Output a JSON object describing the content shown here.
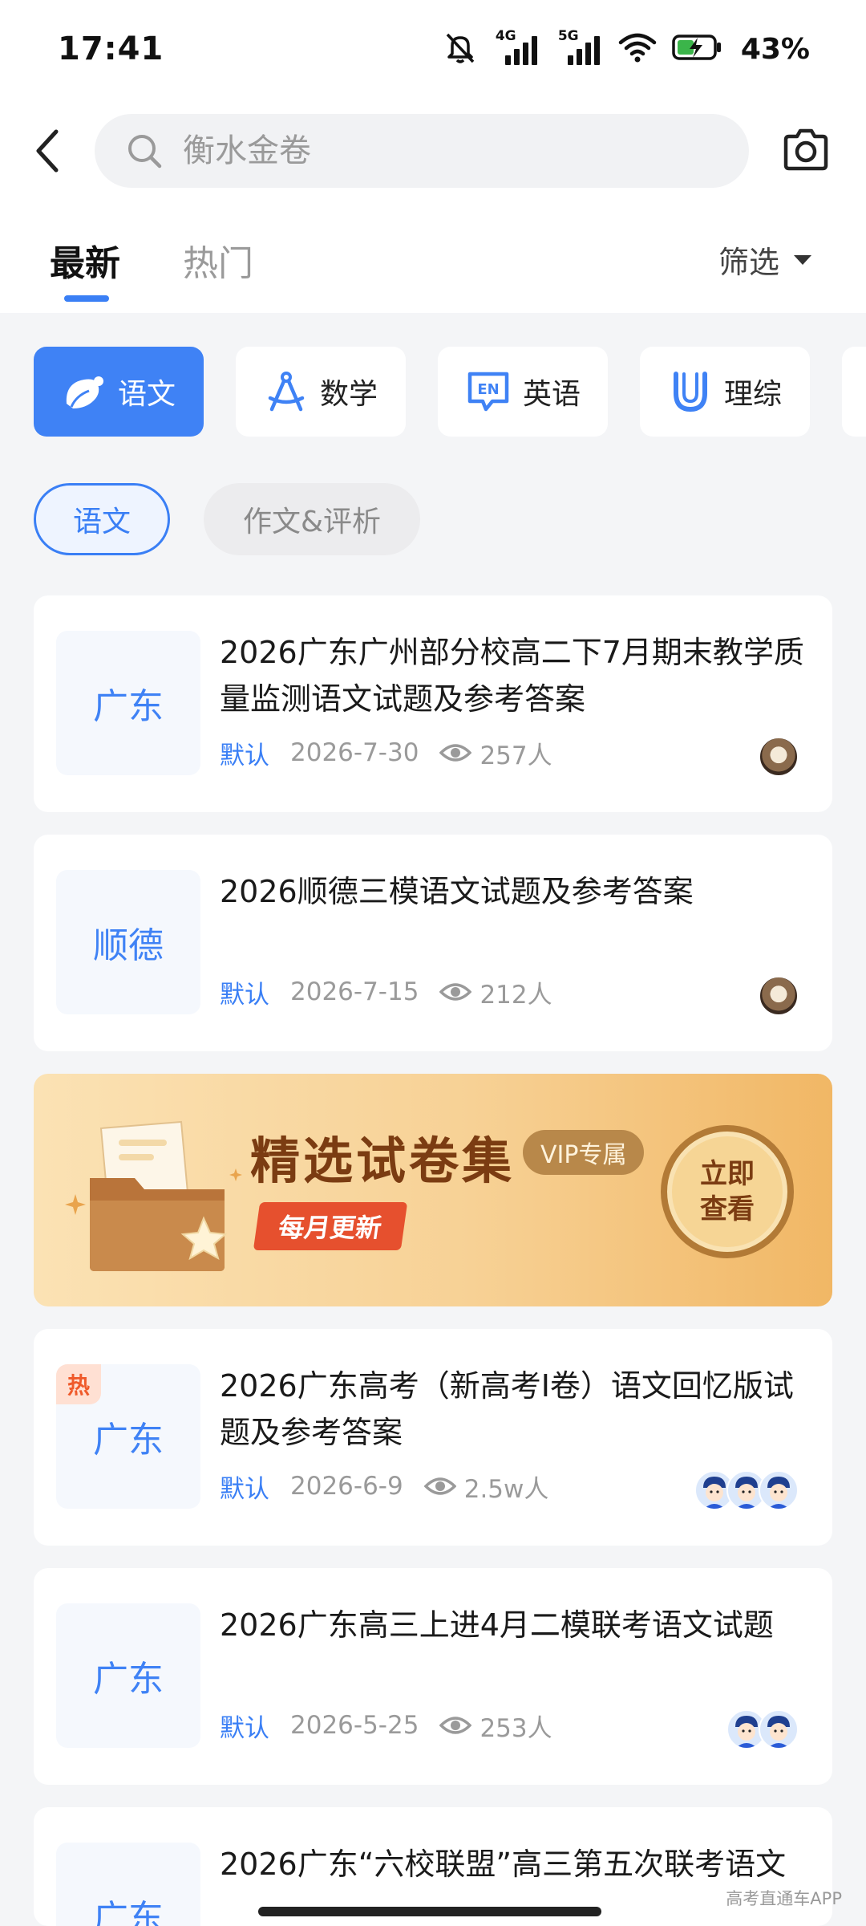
{
  "status_bar": {
    "time": "17:41",
    "network_1": "4G",
    "network_2": "5G",
    "battery": "43%"
  },
  "search": {
    "placeholder": "衡水金卷"
  },
  "tabs": [
    {
      "label": "最新",
      "active": true
    },
    {
      "label": "热门",
      "active": false
    }
  ],
  "filter_label": "筛选",
  "subjects": [
    {
      "label": "语文",
      "icon": "chinese-icon",
      "active": true
    },
    {
      "label": "数学",
      "icon": "compass-icon",
      "active": false
    },
    {
      "label": "英语",
      "icon": "en-icon",
      "active": false
    },
    {
      "label": "理综",
      "icon": "magnet-icon",
      "active": false
    }
  ],
  "sub_categories": [
    {
      "label": "语文",
      "active": true
    },
    {
      "label": "作文&评析",
      "active": false
    }
  ],
  "papers": [
    {
      "region": "广东",
      "hot": false,
      "title": "2026广东广州部分校高二下7月期末教学质量监测语文试题及参考答案",
      "tag": "默认",
      "date": "2026-7-30",
      "views": "257人",
      "avatars": [
        "cat"
      ]
    },
    {
      "region": "顺德",
      "hot": false,
      "title": "2026顺德三模语文试题及参考答案",
      "tag": "默认",
      "date": "2026-7-15",
      "views": "212人",
      "avatars": [
        "cat"
      ]
    },
    {
      "region": "广东",
      "hot": true,
      "hot_label": "热",
      "title": "2026广东高考（新高考Ⅰ卷）语文回忆版试题及参考答案",
      "tag": "默认",
      "date": "2026-6-9",
      "views": "2.5w人",
      "avatars": [
        "boy",
        "boy",
        "boy"
      ]
    },
    {
      "region": "广东",
      "hot": false,
      "title": "2026广东高三上进4月二模联考语文试题",
      "tag": "默认",
      "date": "2026-5-25",
      "views": "253人",
      "avatars": [
        "boy",
        "boy"
      ]
    },
    {
      "region": "广东",
      "hot": false,
      "title": "2026广东“六校联盟”高三第五次联考语文",
      "tag": "",
      "date": "",
      "views": "",
      "avatars": []
    }
  ],
  "banner": {
    "title": "精选试卷集",
    "vip_label": "VIP专属",
    "monthly_label": "每月更新",
    "cta": "立即查看"
  },
  "watermark": "高考直通车APP",
  "colors": {
    "accent": "#3f82f5",
    "hot": "#ef5a2b",
    "banner_text": "#7b3c12"
  }
}
